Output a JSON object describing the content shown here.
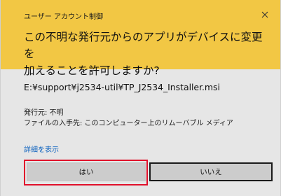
{
  "dialog": {
    "title": "ユーザー アカウント制御",
    "question": "この不明な発行元からのアプリがデバイスに変更を\n加えることを許可しますか?",
    "file_path": "E:¥support¥j2534-util¥TP_J2534_Installer.msi",
    "publisher_line": "発行元: 不明",
    "source_line": "ファイルの入手先: このコンピューター上のリムーバブル メディア",
    "details_link": "詳細を表示",
    "yes_label": "はい",
    "no_label": "いいえ"
  },
  "icons": {
    "close": "close-icon"
  },
  "colors": {
    "header_bg": "#f2c744",
    "body_bg": "#e6e6e6",
    "link": "#1567c0",
    "highlight": "#e0102b",
    "button_bg": "#cccccc"
  }
}
